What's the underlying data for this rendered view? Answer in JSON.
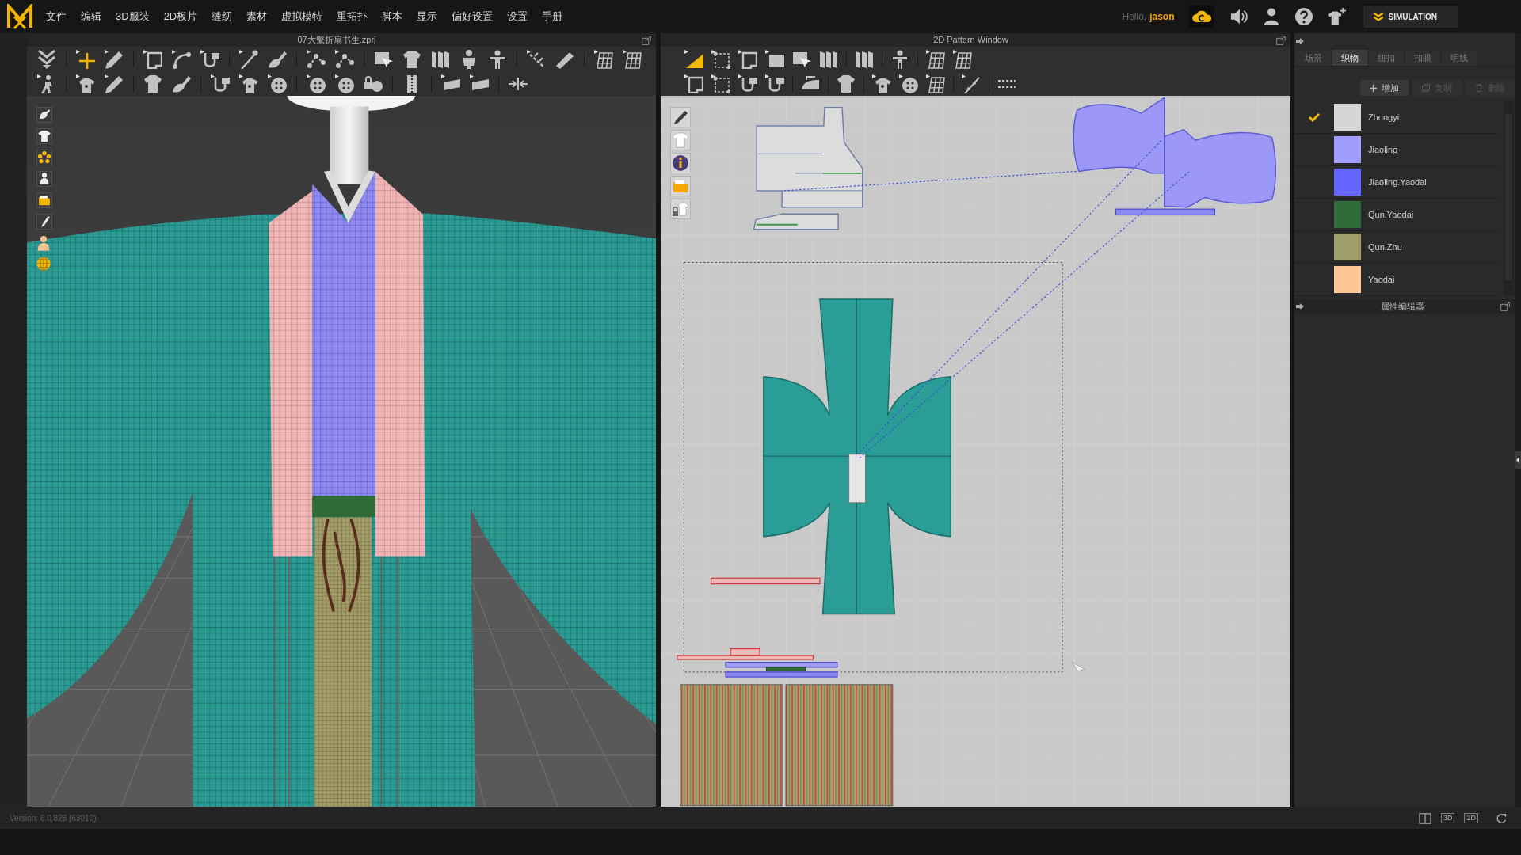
{
  "menu_bar": {
    "items": [
      "文件",
      "编辑",
      "3D服装",
      "2D板片",
      "缝纫",
      "素材",
      "虚拟模特",
      "重拓扑",
      "脚本",
      "显示",
      "偏好设置",
      "设置",
      "手册"
    ]
  },
  "account": {
    "greeting": "Hello,",
    "user_name": "jason"
  },
  "mode_button": {
    "label": "SIMULATION"
  },
  "window_3d": {
    "title": "07大氅折扇书生.zprj"
  },
  "window_2d": {
    "title": "2D Pattern Window"
  },
  "object_browser": {
    "tabs": [
      {
        "label": "场景",
        "selected": false
      },
      {
        "label": "织物",
        "selected": true
      },
      {
        "label": "纽扣",
        "selected": false
      },
      {
        "label": "扣眼",
        "selected": false
      },
      {
        "label": "明线",
        "selected": false
      }
    ],
    "actions": [
      {
        "kind": "add",
        "label": "增加",
        "disabled": false
      },
      {
        "kind": "copy",
        "label": "复制",
        "disabled": true
      },
      {
        "kind": "delete",
        "label": "删除",
        "disabled": true
      }
    ],
    "fabrics": [
      {
        "name": "Zhongyi",
        "color": "#d6d6d6",
        "checked": true
      },
      {
        "name": "Jiaoling",
        "color": "#a19dff",
        "checked": false
      },
      {
        "name": "Jiaoling.Yaodai",
        "color": "#6565ff",
        "checked": false
      },
      {
        "name": "Qun.Yaodai",
        "color": "#2f6b38",
        "checked": false
      },
      {
        "name": "Qun.Zhu",
        "color": "#9d9e6b",
        "checked": false
      },
      {
        "name": "Yaodai",
        "color": "#fcc696",
        "checked": false
      }
    ]
  },
  "property_editor": {
    "title": "属性编辑器"
  },
  "status_bar": {
    "version": "Version: 6.0.828 (63010)",
    "view_buttons": [
      "3D",
      "2D"
    ]
  }
}
